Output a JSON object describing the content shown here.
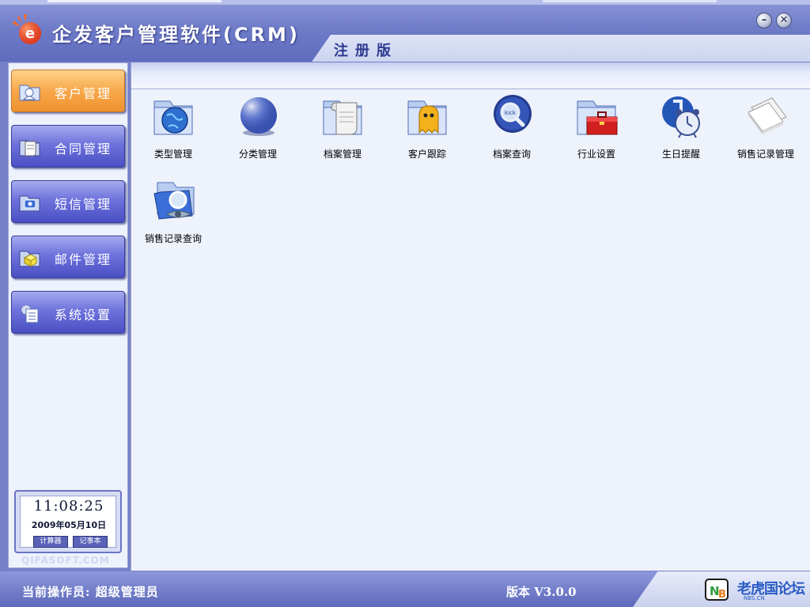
{
  "header": {
    "title": "企发客户管理软件(CRM)",
    "edition": "注册版",
    "minimize_icon": "minimize-icon",
    "close_icon": "close-icon",
    "minimize_glyph": "–",
    "close_glyph": "✕"
  },
  "sidebar": {
    "items": [
      {
        "label": "客户管理",
        "icon": "folder-user-icon",
        "active": true
      },
      {
        "label": "合同管理",
        "icon": "scroll-icon",
        "active": false
      },
      {
        "label": "短信管理",
        "icon": "message-icon",
        "active": false
      },
      {
        "label": "邮件管理",
        "icon": "mail-box-icon",
        "active": false
      },
      {
        "label": "系统设置",
        "icon": "settings-doc-icon",
        "active": false
      }
    ],
    "clock": {
      "time": "11:08:25",
      "date": "2009年05月10日",
      "calculator_label": "计算器",
      "notepad_label": "记事本"
    },
    "watermark": "QIFASOFT.COM"
  },
  "main": {
    "items": [
      {
        "label": "类型管理",
        "icon": "globe-folder-icon"
      },
      {
        "label": "分类管理",
        "icon": "sphere-icon"
      },
      {
        "label": "档案管理",
        "icon": "scroll-folder-icon"
      },
      {
        "label": "客户跟踪",
        "icon": "ghost-folder-icon"
      },
      {
        "label": "档案查询",
        "icon": "magnifier-icon"
      },
      {
        "label": "行业设置",
        "icon": "toolbox-folder-icon"
      },
      {
        "label": "生日提醒",
        "icon": "alarm-clock-icon"
      },
      {
        "label": "销售记录管理",
        "icon": "papers-icon"
      },
      {
        "label": "销售记录查询",
        "icon": "search-folder-icon"
      }
    ]
  },
  "statusbar": {
    "operator": "当前操作员: 超级管理员",
    "version": "版本 V3.0.0",
    "logo_text": "老虎国论坛",
    "logo_sub": "NBS.CN"
  },
  "colors": {
    "header": "#6f7cc8",
    "active_nav": "#f7a84a",
    "nav": "#6e73dc",
    "content_bg": "#eef2fb"
  }
}
